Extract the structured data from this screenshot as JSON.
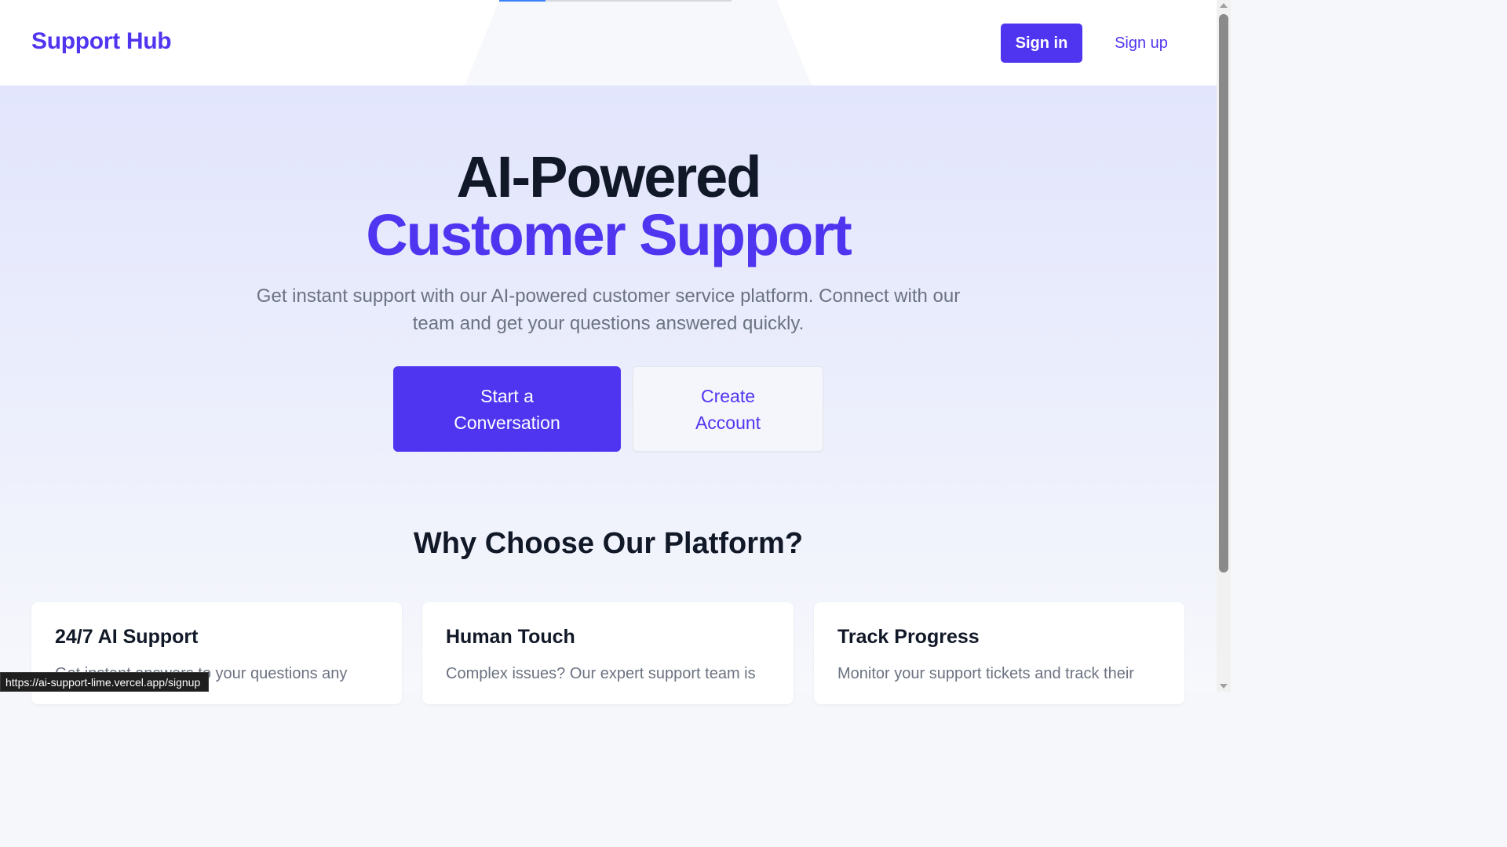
{
  "header": {
    "brand": "Support Hub",
    "sign_in_label": "Sign in",
    "sign_up_label": "Sign up"
  },
  "hero": {
    "title_line1": "AI-Powered",
    "title_line2": "Customer Support",
    "subtitle": "Get instant support with our AI-powered customer service platform. Connect with our team and get your questions answered quickly.",
    "cta_primary": "Start a Conversation",
    "cta_secondary": "Create Account"
  },
  "features": {
    "heading": "Why Choose Our Platform?",
    "cards": [
      {
        "title": "24/7 AI Support",
        "desc": "Get instant answers to your questions any"
      },
      {
        "title": "Human Touch",
        "desc": "Complex issues? Our expert support team is"
      },
      {
        "title": "Track Progress",
        "desc": "Monitor your support tickets and track their"
      }
    ]
  },
  "status_bar": {
    "url": "https://ai-support-lime.vercel.app/signup"
  },
  "colors": {
    "brand": "#4f35f0",
    "heading": "#111827",
    "muted": "#6b7280"
  }
}
